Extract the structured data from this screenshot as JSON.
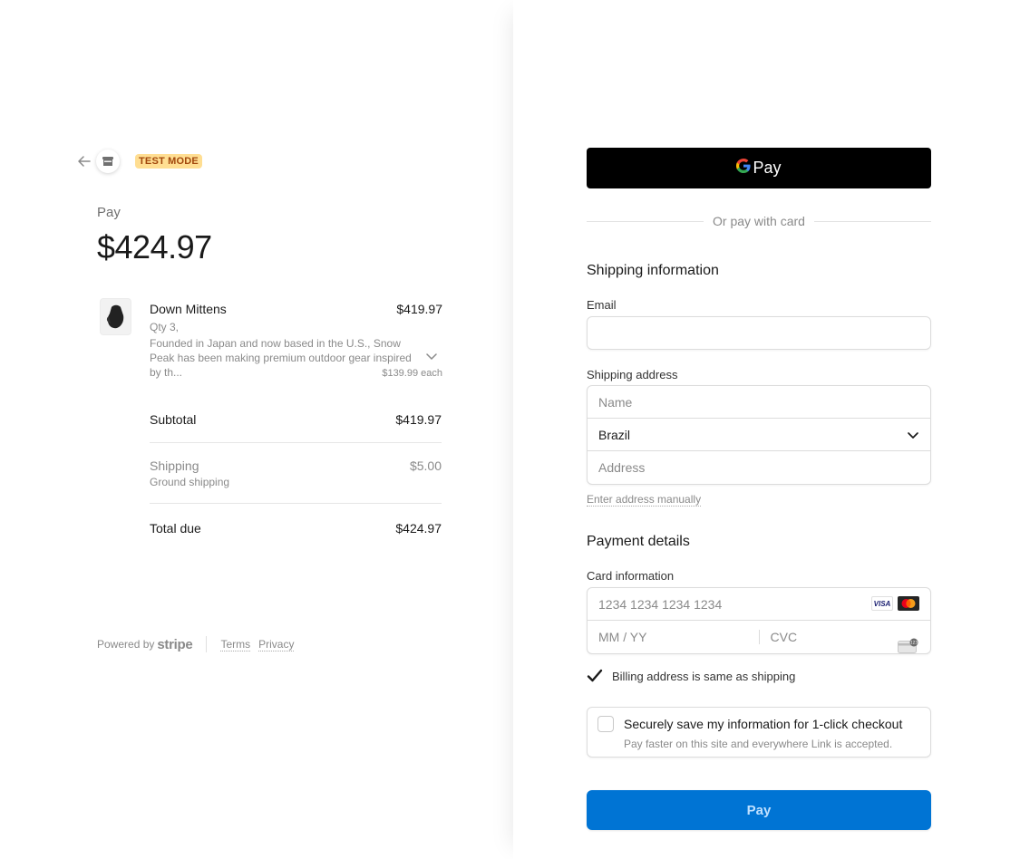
{
  "header": {
    "test_mode_label": "TEST MODE",
    "icons": {
      "back": "arrow-left-icon",
      "store": "store-icon"
    }
  },
  "summary": {
    "pay_label": "Pay",
    "amount": "$424.97",
    "item": {
      "name": "Down Mittens",
      "price": "$419.97",
      "qty": "Qty 3,",
      "description": "Founded in Japan and now based in the U.S., Snow Peak has been making premium outdoor gear inspired by th...",
      "each": "$139.99 each"
    },
    "subtotal_label": "Subtotal",
    "subtotal_value": "$419.97",
    "shipping_label": "Shipping",
    "shipping_method": "Ground shipping",
    "shipping_value": "$5.00",
    "total_label": "Total due",
    "total_value": "$424.97"
  },
  "footer": {
    "powered_by": "Powered by",
    "brand": "stripe",
    "terms": "Terms",
    "privacy": "Privacy"
  },
  "checkout": {
    "gpay_word": "Pay",
    "or_text": "Or pay with card",
    "shipping_title": "Shipping information",
    "email_label": "Email",
    "email_value": "",
    "shipping_address_label": "Shipping address",
    "name_placeholder": "Name",
    "country_value": "Brazil",
    "address_placeholder": "Address",
    "manual_link": "Enter address manually",
    "payment_title": "Payment details",
    "card_info_label": "Card information",
    "card_number_placeholder": "1234 1234 1234 1234",
    "expiry_placeholder": "MM / YY",
    "cvc_placeholder": "CVC",
    "visa_text": "VISA",
    "billing_same_label": "Billing address is same as shipping",
    "billing_same_checked": true,
    "link_title": "Securely save my information for 1-click checkout",
    "link_sub": "Pay faster on this site and everywhere Link is accepted.",
    "pay_button": "Pay",
    "colors": {
      "pay_button_bg": "#0074d4",
      "test_mode_bg": "#ffde92",
      "test_mode_text": "#a2470c"
    }
  }
}
